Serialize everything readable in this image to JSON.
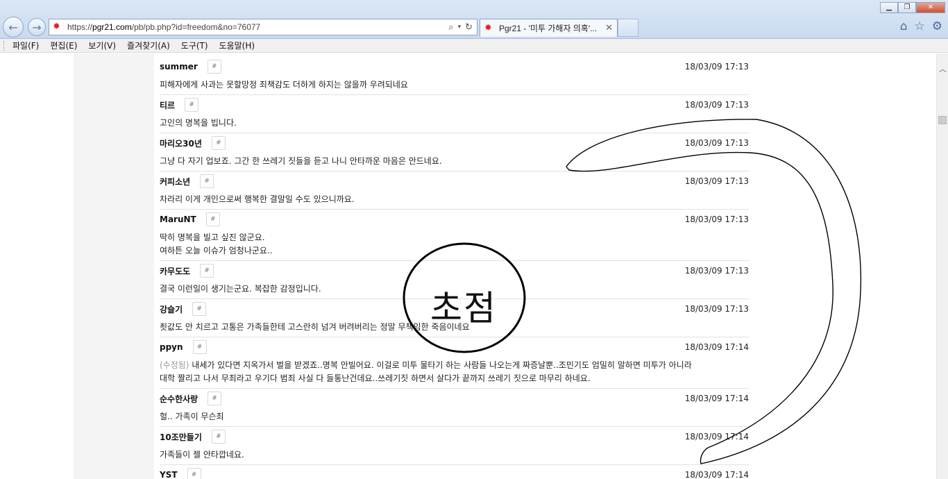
{
  "browser": {
    "url_prefix": "https://",
    "url_domain": "pgr21.com",
    "url_path": "/pb/pb.php?id=freedom&no=76077",
    "tab_title": "Pgr21 - '미투 가해자 의혹'...",
    "window_minimize": "▁",
    "window_maximize": "❐",
    "window_close": "✕"
  },
  "menu": [
    "파일(F)",
    "편집(E)",
    "보기(V)",
    "즐겨찾기(A)",
    "도구(T)",
    "도움말(H)"
  ],
  "hash_label": "#",
  "comments": [
    {
      "nick": "summer",
      "date": "18/03/09 17:13",
      "lines": [
        "피해자에게 사과는 못할망정 죄책감도 더하게 하지는 않을까 우려되네요"
      ]
    },
    {
      "nick": "티르",
      "date": "18/03/09 17:13",
      "lines": [
        "고인의 명복을 빕니다."
      ]
    },
    {
      "nick": "마리오30년",
      "date": "18/03/09 17:13",
      "lines": [
        "그냥 다 자기 업보죠. 그간 한 쓰레기 짓들을 듣고 나니 안타까운 마음은 안드네요."
      ]
    },
    {
      "nick": "커피소년",
      "date": "18/03/09 17:13",
      "lines": [
        "차라리 이게 개인으로써 행복한 결말일 수도 있으니까요."
      ]
    },
    {
      "nick": "MaruNT",
      "date": "18/03/09 17:13",
      "lines": [
        "딱히 명복을 빌고 싶진 않군요.",
        "여하튼 오늘 이슈가 엄청나군요.."
      ]
    },
    {
      "nick": "카무도도",
      "date": "18/03/09 17:13",
      "lines": [
        "결국 이런일이 생기는군요. 복잡한 감정입니다."
      ]
    },
    {
      "nick": "강슬기",
      "date": "18/03/09 17:13",
      "lines": [
        "죗값도 안 치르고 고통은 가족들한테 고스란히 넘겨 버려버리는 정말 무책임한 죽음이네요"
      ]
    },
    {
      "nick": "ppyn",
      "date": "18/03/09 17:14",
      "edited": "(수정됨)",
      "lines": [
        "내세가 있다면 지옥가서 벌을 받겠죠..명복 안빌어요. 이걸로 미투 물타기 하는 사람들 나오는게 짜증날뿐..조민기도 엄밀히 말하면 미투가 아니라",
        "대학 짤리고 나서 무죄라고 우기다 범죄 사실 다 들통난건데요..쓰레기짓 하면서 살다가 끝까지 쓰레기 짓으로 마무리 하네요."
      ]
    },
    {
      "nick": "순수한사랑",
      "date": "18/03/09 17:14",
      "lines": [
        "헐.. 가족이 무슨죄"
      ]
    },
    {
      "nick": "10조만들기",
      "date": "18/03/09 17:14",
      "lines": [
        "가족들이 젤 안타깝네요."
      ]
    },
    {
      "nick": "YST",
      "date": "18/03/09 17:14",
      "lines": []
    }
  ],
  "annotation": {
    "focus_text": "초점"
  }
}
